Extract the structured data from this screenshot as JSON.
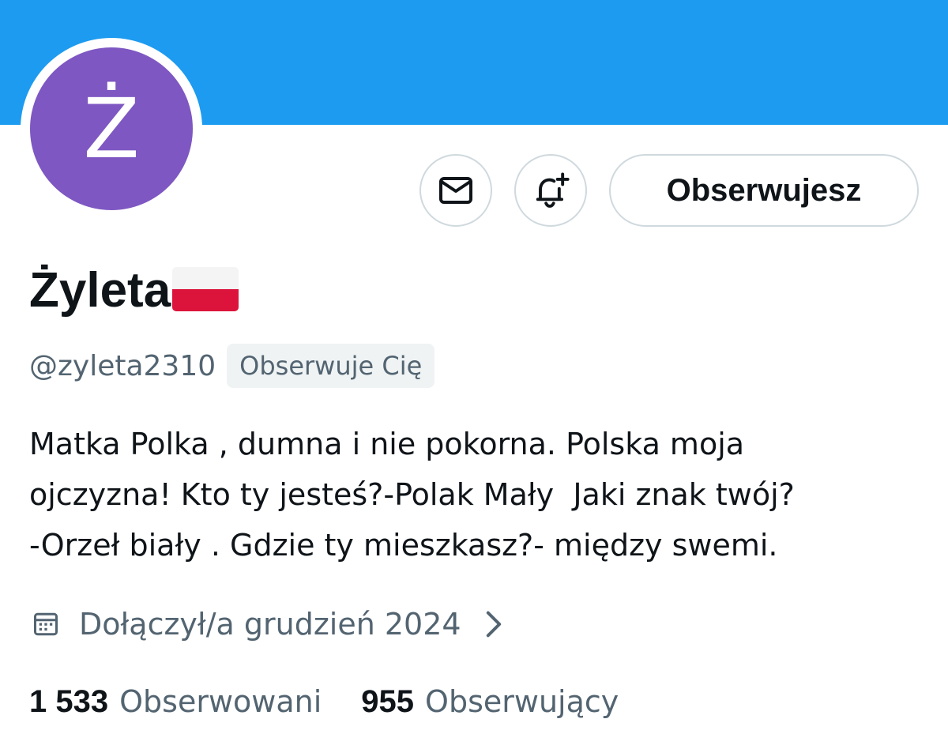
{
  "profile": {
    "avatar_letter": "Ż",
    "avatar_color": "#7e57c2",
    "banner_color": "#1d9bf0",
    "display_name": "Żyleta",
    "handle": "@zyleta2310",
    "follows_you_badge": "Obserwuje Cię",
    "bio_lines": [
      "Matka Polka , dumna i nie pokorna. Polska moja",
      "ojczyzna! Kto ty jesteś?-Polak Mały  Jaki znak twój?",
      "-Orzeł biały . Gdzie ty mieszkasz?- między swemi."
    ],
    "joined": "Dołączył/a grudzień 2024"
  },
  "actions": {
    "message_icon": "envelope-icon",
    "notify_icon": "bell-plus-icon",
    "follow_button_label": "Obserwujesz"
  },
  "stats": {
    "following_count": "1 533",
    "following_label": "Obserwowani",
    "followers_count": "955",
    "followers_label": "Obserwujący"
  }
}
